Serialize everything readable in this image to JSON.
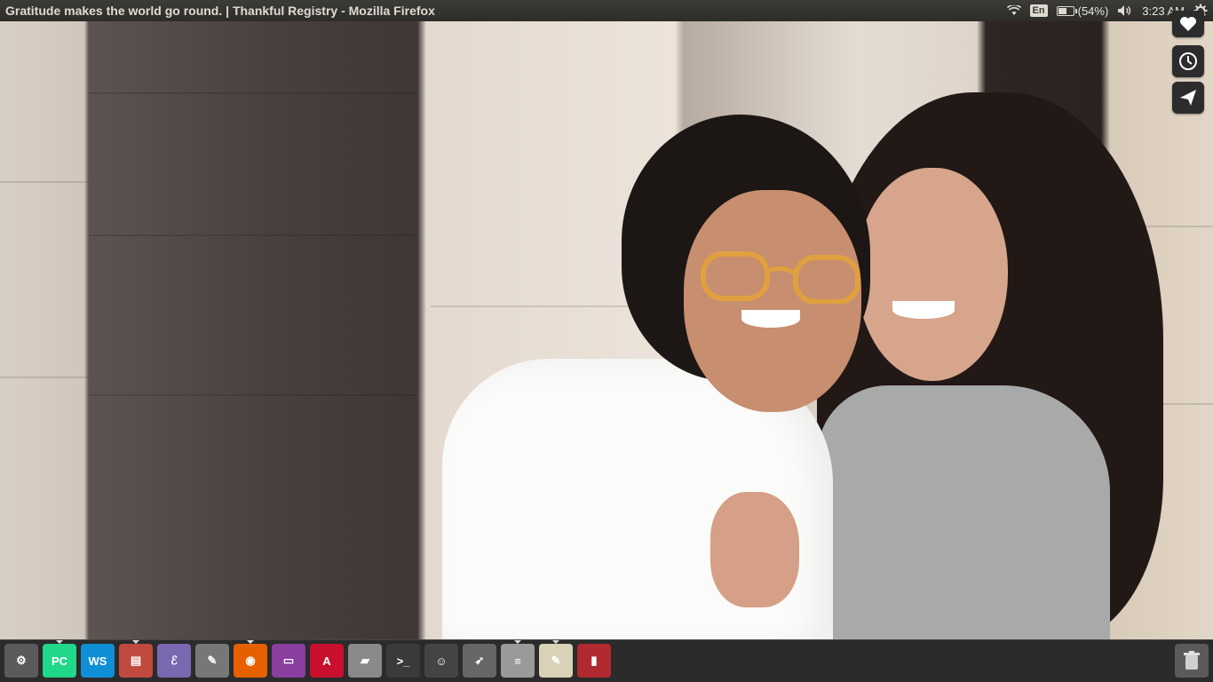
{
  "window": {
    "title": "Gratitude makes the world go round. | Thankful Registry - Mozilla Firefox"
  },
  "indicators": {
    "wifi": "wifi-icon",
    "keyboard_layout": "En",
    "battery_icon": "battery-icon",
    "battery_text": "(54%)",
    "battery_level": 0.54,
    "volume": "volume-icon",
    "time": "3:23 AM",
    "settings": "gear-icon"
  },
  "side_buttons": [
    {
      "icon": "heart-icon"
    },
    {
      "icon": "clock-icon"
    },
    {
      "icon": "send-icon"
    }
  ],
  "launcher": {
    "items": [
      {
        "name": "ubuntu-dash",
        "glyph": "⚙",
        "color": "#5a5a5a"
      },
      {
        "name": "pycharm",
        "glyph": "PC",
        "color": "#21d789"
      },
      {
        "name": "webstorm",
        "glyph": "WS",
        "color": "#0f8fd6"
      },
      {
        "name": "archive-manager",
        "glyph": "▤",
        "color": "#c04a3f"
      },
      {
        "name": "emacs",
        "glyph": "ℰ",
        "color": "#7a68b0"
      },
      {
        "name": "system-tools",
        "glyph": "✎",
        "color": "#777777"
      },
      {
        "name": "firefox",
        "glyph": "◉",
        "color": "#e66000"
      },
      {
        "name": "terminal-purple",
        "glyph": "▭",
        "color": "#8a3ea0"
      },
      {
        "name": "android-studio",
        "glyph": "A",
        "color": "#c8102e"
      },
      {
        "name": "disk-drive",
        "glyph": "▰",
        "color": "#8a8a8a"
      },
      {
        "name": "terminal",
        "glyph": ">_",
        "color": "#3a3a3a"
      },
      {
        "name": "tux-app",
        "glyph": "☺",
        "color": "#444444"
      },
      {
        "name": "rocket-app",
        "glyph": "➶",
        "color": "#666666"
      },
      {
        "name": "database",
        "glyph": "≡",
        "color": "#9a9a9a"
      },
      {
        "name": "text-editor",
        "glyph": "✎",
        "color": "#d9d2b8"
      },
      {
        "name": "book-app",
        "glyph": "▮",
        "color": "#b02a30"
      }
    ],
    "trash": "trash-icon"
  }
}
